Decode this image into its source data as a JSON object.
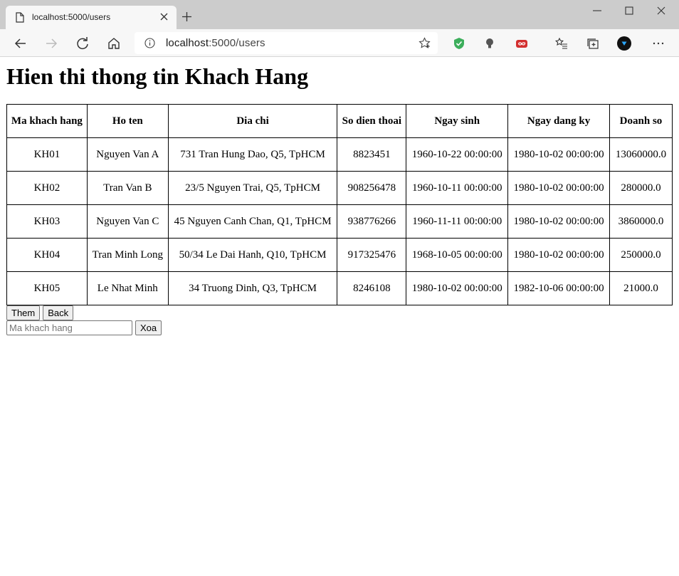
{
  "browser": {
    "tab_title": "localhost:5000/users",
    "url_host": "localhost",
    "url_rest": ":5000/users"
  },
  "page": {
    "title": "Hien thi thong tin Khach Hang",
    "headers": [
      "Ma khach hang",
      "Ho ten",
      "Dia chi",
      "So dien thoai",
      "Ngay sinh",
      "Ngay dang ky",
      "Doanh so"
    ],
    "rows": [
      [
        "KH01",
        "Nguyen Van A",
        "731 Tran Hung Dao, Q5, TpHCM",
        "8823451",
        "1960-10-22 00:00:00",
        "1980-10-02 00:00:00",
        "13060000.0"
      ],
      [
        "KH02",
        "Tran Van B",
        "23/5 Nguyen Trai, Q5, TpHCM",
        "908256478",
        "1960-10-11 00:00:00",
        "1980-10-02 00:00:00",
        "280000.0"
      ],
      [
        "KH03",
        "Nguyen Van C",
        "45 Nguyen Canh Chan, Q1, TpHCM",
        "938776266",
        "1960-11-11 00:00:00",
        "1980-10-02 00:00:00",
        "3860000.0"
      ],
      [
        "KH04",
        "Tran Minh Long",
        "50/34 Le Dai Hanh, Q10, TpHCM",
        "917325476",
        "1968-10-05 00:00:00",
        "1980-10-02 00:00:00",
        "250000.0"
      ],
      [
        "KH05",
        "Le Nhat Minh",
        "34 Truong Dinh, Q3, TpHCM",
        "8246108",
        "1980-10-02 00:00:00",
        "1982-10-06 00:00:00",
        "21000.0"
      ]
    ],
    "add_label": "Them",
    "back_label": "Back",
    "delete_placeholder": "Ma khach hang",
    "delete_label": "Xoa"
  }
}
